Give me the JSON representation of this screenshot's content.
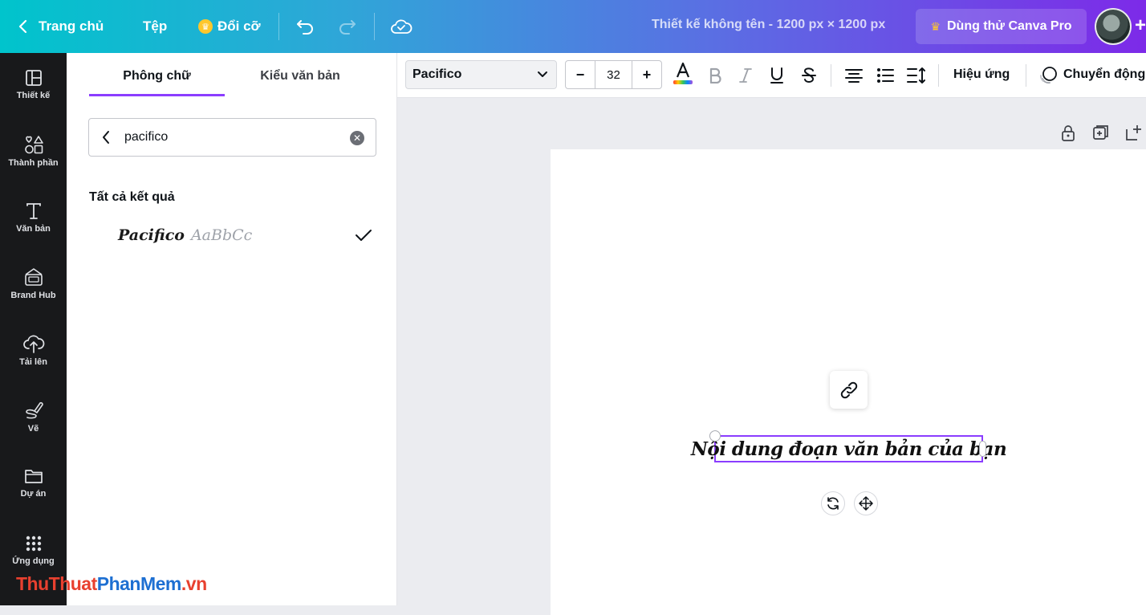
{
  "topbar": {
    "home": "Trang chủ",
    "file": "Tệp",
    "resize": "Đổi cỡ",
    "title": "Thiết kế không tên - 1200 px × 1200 px",
    "pro": "Dùng thử Canva Pro",
    "plus": "+"
  },
  "sidebar": {
    "items": [
      {
        "label": "Thiết kế",
        "icon": "layout-icon"
      },
      {
        "label": "Thành phần",
        "icon": "shapes-icon"
      },
      {
        "label": "Văn bản",
        "icon": "text-icon"
      },
      {
        "label": "Brand Hub",
        "icon": "brand-hub-icon"
      },
      {
        "label": "Tải lên",
        "icon": "upload-cloud-icon"
      },
      {
        "label": "Vẽ",
        "icon": "draw-icon"
      },
      {
        "label": "Dự án",
        "icon": "folder-icon"
      },
      {
        "label": "Ứng dụng",
        "icon": "apps-grid-icon"
      }
    ]
  },
  "watermark": {
    "part1": "ThuThuat",
    "part2": "PhanMem",
    "part3": ".vn"
  },
  "panel": {
    "tabs": [
      "Phông chữ",
      "Kiểu văn bản"
    ],
    "search_value": "pacifico",
    "results_heading": "Tất cả kết quả",
    "result_font": "Pacifico",
    "result_sample": "AaBbCc"
  },
  "toolbar": {
    "font": "Pacifico",
    "minus": "−",
    "size": "32",
    "plus": "+",
    "effects": "Hiệu ứng",
    "animate": "Chuyển động"
  },
  "canvas": {
    "text": "Nội dung đoạn văn bản của bạn"
  },
  "colors": {
    "accent": "#8b3dff",
    "sidebar_bg": "#18191b",
    "topbar_start": "#00c4cc",
    "topbar_end": "#7d2ae8"
  }
}
